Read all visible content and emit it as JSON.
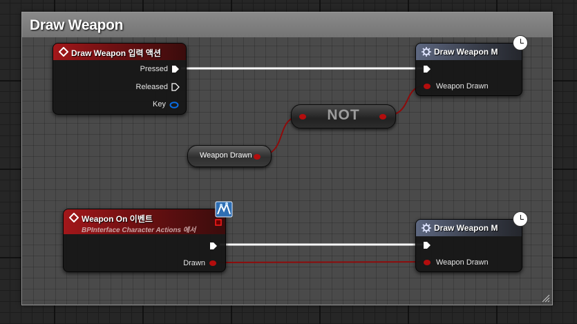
{
  "comment": {
    "title": "Draw Weapon"
  },
  "nodes": {
    "input_action": {
      "title": "Draw Weapon 입력 액션",
      "pins": {
        "pressed": "Pressed",
        "released": "Released",
        "key": "Key"
      }
    },
    "set_top": {
      "title": "Draw Weapon M",
      "pin": "Weapon Drawn"
    },
    "not_node": {
      "label": "NOT"
    },
    "get_var": {
      "label": "Weapon Drawn"
    },
    "event": {
      "title": "Weapon On 이벤트",
      "subtitle": "BPInterface Character Actions 에서",
      "pin": "Drawn"
    },
    "set_bottom": {
      "title": "Draw Weapon M",
      "pin": "Weapon Drawn"
    }
  },
  "icons": {
    "event": "event-diamond-icon",
    "function": "gear-icon",
    "latent": "clock-icon",
    "interface": "interface-message-icon"
  },
  "colors": {
    "exec_wire": "#ffffff",
    "bool_wire": "#8e0b0b",
    "bool_pin": "#b40d0d",
    "struct_pin": "#0a6ee6",
    "event_header": "#a3171a",
    "function_header": "#5d6780"
  }
}
